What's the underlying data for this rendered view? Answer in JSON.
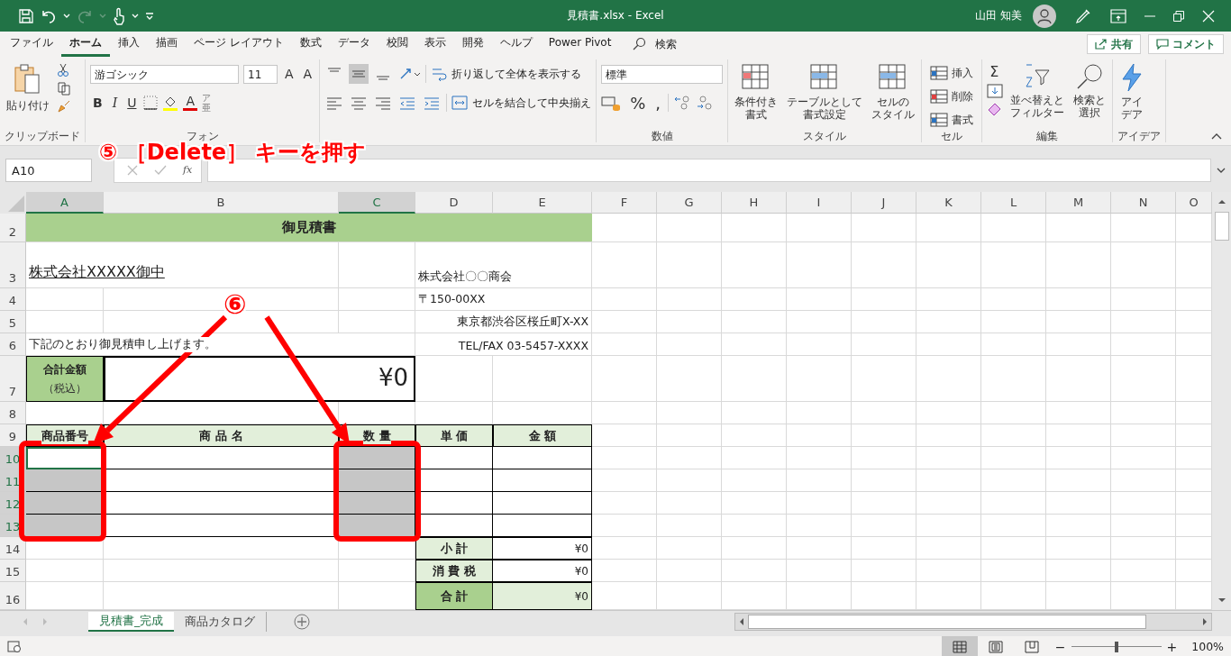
{
  "title_bar": {
    "title": "見積書.xlsx  -  Excel",
    "user": "山田 知美"
  },
  "menu": {
    "tabs": [
      {
        "label": "ファイル",
        "selected": false
      },
      {
        "label": "ホーム",
        "selected": true
      },
      {
        "label": "挿入",
        "selected": false
      },
      {
        "label": "描画",
        "selected": false
      },
      {
        "label": "ページ レイアウト",
        "selected": false
      },
      {
        "label": "数式",
        "selected": false
      },
      {
        "label": "データ",
        "selected": false
      },
      {
        "label": "校閲",
        "selected": false
      },
      {
        "label": "表示",
        "selected": false
      },
      {
        "label": "開発",
        "selected": false
      },
      {
        "label": "ヘルプ",
        "selected": false
      },
      {
        "label": "Power Pivot",
        "selected": false
      }
    ],
    "search": "検索",
    "share": "共有",
    "comment": "コメント"
  },
  "ribbon": {
    "clipboard": {
      "paste": "貼り付け",
      "label": "クリップボード"
    },
    "font": {
      "name": "游ゴシック",
      "size": "11",
      "grow": "A",
      "shrink": "A",
      "bold": "B",
      "italic": "I",
      "underline": "U",
      "font_color": "A",
      "phonetic": "ア亜",
      "label": "フォン"
    },
    "alignment": {
      "vertical": [
        {
          "selected": false
        },
        {
          "selected": true
        },
        {
          "selected": false
        }
      ],
      "wrap": "折り返して全体を表示する",
      "merge": "セルを結合して中央揃え"
    },
    "number": {
      "format": "標準",
      "percent": "%",
      "comma": ",",
      "label": "数値"
    },
    "styles": {
      "buttons": [
        {
          "lines": [
            "条件付き",
            "書式"
          ]
        },
        {
          "lines": [
            "テーブルとして",
            "書式設定"
          ]
        },
        {
          "lines": [
            "セルの",
            "スタイル"
          ]
        }
      ],
      "label": "スタイル"
    },
    "cells": {
      "buttons": [
        "挿入",
        "削除",
        "書式"
      ],
      "label": "セル"
    },
    "editing": {
      "sum": "Σ",
      "sort": [
        "並べ替えと",
        "フィルター"
      ],
      "find": [
        "検索と",
        "選択"
      ],
      "label": "編集"
    },
    "ideas": {
      "button": [
        "アイ",
        "デア"
      ],
      "label": "アイデア"
    }
  },
  "formula_bar": {
    "name_box": "A10",
    "function": "fx"
  },
  "sheet": {
    "columns": [
      {
        "label": "A",
        "selected": true
      },
      {
        "label": "B",
        "selected": false
      },
      {
        "label": "C",
        "selected": true
      },
      {
        "label": "D",
        "selected": false
      },
      {
        "label": "E",
        "selected": false
      },
      {
        "label": "F",
        "selected": false
      },
      {
        "label": "G",
        "selected": false
      },
      {
        "label": "H",
        "selected": false
      },
      {
        "label": "I",
        "selected": false
      },
      {
        "label": "J",
        "selected": false
      },
      {
        "label": "K",
        "selected": false
      },
      {
        "label": "L",
        "selected": false
      },
      {
        "label": "M",
        "selected": false
      },
      {
        "label": "N",
        "selected": false
      },
      {
        "label": "O",
        "selected": false
      }
    ],
    "rows": [
      {
        "number": "2",
        "selected": false,
        "cells": [
          {
            "kind": "title",
            "text": "御見積書"
          },
          {
            "kind": "merged"
          },
          {
            "kind": "merged"
          },
          {
            "kind": "merged"
          },
          {
            "kind": "merged"
          }
        ]
      },
      {
        "number": "3",
        "selected": false,
        "cells": [
          {
            "kind": "addressee",
            "text": "株式会社XXXXX御中"
          },
          {
            "kind": "merged"
          },
          {
            "kind": "blank"
          },
          {
            "kind": "text",
            "text": "株式会社〇〇商会"
          },
          {
            "kind": "merged"
          }
        ]
      },
      {
        "number": "4",
        "selected": false,
        "cells": [
          {
            "kind": "blank"
          },
          {
            "kind": "blank"
          },
          {
            "kind": "blank"
          },
          {
            "kind": "text",
            "text": "〒150-00XX"
          },
          {
            "kind": "merged"
          }
        ]
      },
      {
        "number": "5",
        "selected": false,
        "cells": [
          {
            "kind": "blank"
          },
          {
            "kind": "blank"
          },
          {
            "kind": "blank"
          },
          {
            "kind": "text-right",
            "text": "東京都渋谷区桜丘町X-XX"
          },
          {
            "kind": "merged"
          }
        ]
      },
      {
        "number": "6",
        "selected": false,
        "cells": [
          {
            "kind": "text",
            "text": "下記のとおり御見積申し上げます。"
          },
          {
            "kind": "merged"
          },
          {
            "kind": "merged"
          },
          {
            "kind": "text-right",
            "text": "TEL/FAX 03-5457-XXXX"
          },
          {
            "kind": "merged"
          }
        ]
      },
      {
        "number": "7",
        "selected": false,
        "cells": [
          {
            "kind": "total-label",
            "text": "合計金額",
            "note": "（税込）"
          },
          {
            "kind": "total-value",
            "text": "¥0"
          },
          {
            "kind": "merged"
          },
          {
            "kind": "blank"
          },
          {
            "kind": "blank"
          }
        ]
      },
      {
        "number": "8",
        "selected": false,
        "cells": [
          {
            "kind": "blank"
          },
          {
            "kind": "blank"
          },
          {
            "kind": "blank"
          },
          {
            "kind": "blank"
          },
          {
            "kind": "blank"
          }
        ]
      },
      {
        "number": "9",
        "selected": false,
        "cells": [
          {
            "kind": "header",
            "text": "商品番号"
          },
          {
            "kind": "header",
            "text": "商 品 名"
          },
          {
            "kind": "header",
            "text": "数 量"
          },
          {
            "kind": "header",
            "text": "単 価"
          },
          {
            "kind": "header",
            "text": "金 額"
          }
        ]
      },
      {
        "number": "10",
        "selected": true,
        "cells": [
          {
            "kind": "active"
          },
          {
            "kind": "body"
          },
          {
            "kind": "selected"
          },
          {
            "kind": "body"
          },
          {
            "kind": "body"
          }
        ]
      },
      {
        "number": "11",
        "selected": true,
        "cells": [
          {
            "kind": "selected"
          },
          {
            "kind": "body"
          },
          {
            "kind": "selected"
          },
          {
            "kind": "body"
          },
          {
            "kind": "body"
          }
        ]
      },
      {
        "number": "12",
        "selected": true,
        "cells": [
          {
            "kind": "selected"
          },
          {
            "kind": "body"
          },
          {
            "kind": "selected"
          },
          {
            "kind": "body"
          },
          {
            "kind": "body"
          }
        ]
      },
      {
        "number": "13",
        "selected": true,
        "cells": [
          {
            "kind": "selected"
          },
          {
            "kind": "body"
          },
          {
            "kind": "selected"
          },
          {
            "kind": "body"
          },
          {
            "kind": "body"
          }
        ]
      },
      {
        "number": "14",
        "selected": false,
        "cells": [
          {
            "kind": "blank"
          },
          {
            "kind": "blank"
          },
          {
            "kind": "blank"
          },
          {
            "kind": "header",
            "text": "小 計"
          },
          {
            "kind": "amount",
            "text": "¥0"
          }
        ]
      },
      {
        "number": "15",
        "selected": false,
        "cells": [
          {
            "kind": "blank"
          },
          {
            "kind": "blank"
          },
          {
            "kind": "blank"
          },
          {
            "kind": "header",
            "text": "消 費 税"
          },
          {
            "kind": "amount",
            "text": "¥0"
          }
        ]
      },
      {
        "number": "16",
        "selected": false,
        "cells": [
          {
            "kind": "blank"
          },
          {
            "kind": "blank"
          },
          {
            "kind": "blank"
          },
          {
            "kind": "grand-label",
            "text": "合 計"
          },
          {
            "kind": "grand-amount",
            "text": "¥0"
          }
        ]
      }
    ]
  },
  "sheet_tabs": [
    {
      "label": "見積書_完成",
      "selected": true
    },
    {
      "label": "商品カタログ",
      "selected": false
    }
  ],
  "status_bar": {
    "views": [
      {
        "selected": true
      },
      {
        "selected": false
      },
      {
        "selected": false
      }
    ],
    "zoom": {
      "minus": "−",
      "plus": "+",
      "level": 0.5,
      "reading": "100%"
    }
  },
  "annotations": {
    "step5": "⑤ ［Delete］ キーを押す",
    "step6": "⑥"
  }
}
